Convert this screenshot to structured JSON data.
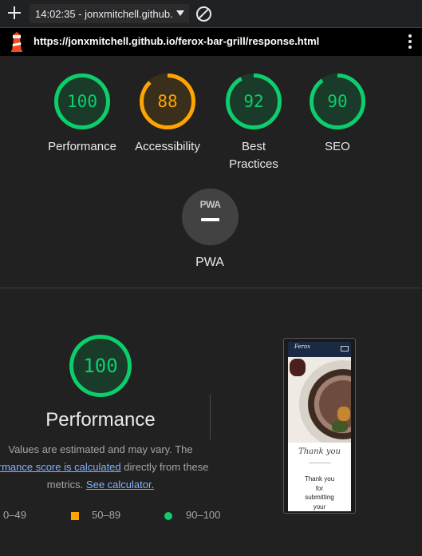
{
  "toolbar": {
    "run_label": "14:02:35 - jonxmitchell.github.",
    "url": "https://jonxmitchell.github.io/ferox-bar-grill/response.html"
  },
  "categories": [
    {
      "key": "performance",
      "score": 100,
      "label": "Performance"
    },
    {
      "key": "accessibility",
      "score": 88,
      "label": "Accessibility"
    },
    {
      "key": "best_practices",
      "score": 92,
      "label": "Best\nPractices"
    },
    {
      "key": "seo",
      "score": 90,
      "label": "SEO"
    }
  ],
  "pwa": {
    "badge_text": "PWA",
    "label": "PWA"
  },
  "detail": {
    "score": 100,
    "title": "Performance",
    "desc_line1": "Values are estimated and may vary. The",
    "desc_link1": "ormance score is calculated",
    "desc_line2_rest": " directly from these",
    "desc_line3_pre": "metrics. ",
    "desc_link2": "See calculator."
  },
  "legend": {
    "fail": "0–49",
    "average": "50–89",
    "pass": "90–100"
  },
  "phone": {
    "brand": "Ferox",
    "thanks_script": "Thank you",
    "message": "Thank you for submitting your"
  },
  "colors": {
    "pass": "#0cce6b",
    "pass_text": "#0cce6b",
    "pass_bg": "#1a3a2a",
    "average": "#ffa400",
    "average_text": "#ffa400",
    "average_bg": "#3a2f1a"
  }
}
